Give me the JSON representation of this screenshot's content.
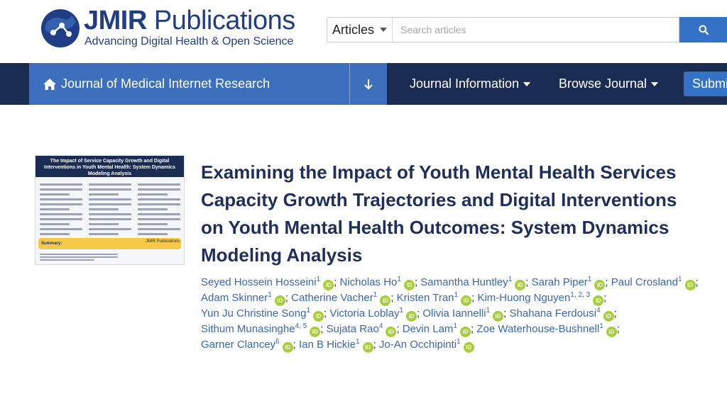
{
  "brand": {
    "name_bold": "JMIR",
    "name_rest": " Publications",
    "tagline": "Advancing Digital Health & Open Science"
  },
  "search": {
    "scope": "Articles",
    "placeholder": "Search articles",
    "button_icon": "search-icon"
  },
  "nav": {
    "journal": "Journal of Medical Internet Research",
    "journal_icon": "home-icon",
    "down_icon": "arrow-down-icon",
    "journal_info": "Journal Information",
    "browse": "Browse Journal",
    "submit": "Submit"
  },
  "colors": {
    "navy": "#1b2c52",
    "accent_blue": "#3d6fbf",
    "search_blue": "#3473c8",
    "author_blue": "#3a66b8",
    "orcid_green": "#a6ce39"
  },
  "article": {
    "title": "Examining the Impact of Youth Mental Health Services Capacity Growth Trajectories and Digital Interventions on Youth Mental Health Outcomes: System Dynamics Modeling Analysis",
    "graphical_abstract": {
      "heading": "The Impact of Service Capacity Growth and Digital Interventions in Youth Mental Health: System Dynamics Modeling Analysis",
      "summary_label": "Summary:",
      "logo": "JMIR Publications"
    },
    "authors": [
      {
        "name": "Seyed Hossein Hosseini",
        "aff": "1"
      },
      {
        "name": "Nicholas Ho",
        "aff": "1"
      },
      {
        "name": "Samantha Huntley",
        "aff": "1"
      },
      {
        "name": "Sarah Piper",
        "aff": "1"
      },
      {
        "name": "Paul Crosland",
        "aff": "1"
      },
      {
        "name": "Adam Skinner",
        "aff": "1"
      },
      {
        "name": "Catherine Vacher",
        "aff": "1"
      },
      {
        "name": "Kristen Tran",
        "aff": "1"
      },
      {
        "name": "Kim-Huong Nguyen",
        "aff": "1, 2, 3"
      },
      {
        "name": "Yun Ju Christine Song",
        "aff": "1"
      },
      {
        "name": "Victoria Loblay",
        "aff": "1"
      },
      {
        "name": "Olivia Iannelli",
        "aff": "1"
      },
      {
        "name": "Shahana Ferdousi",
        "aff": "4"
      },
      {
        "name": "Sithum Munasinghe",
        "aff": "4, 5"
      },
      {
        "name": "Sujata Rao",
        "aff": "4"
      },
      {
        "name": "Devin Lam",
        "aff": "1"
      },
      {
        "name": "Zoe Waterhouse-Bushnell",
        "aff": "1"
      },
      {
        "name": "Garner Clancey",
        "aff": "6"
      },
      {
        "name": "Ian B Hickie",
        "aff": "1"
      },
      {
        "name": "Jo-An Occhipinti",
        "aff": "1"
      }
    ],
    "orcid_label": "iD"
  }
}
